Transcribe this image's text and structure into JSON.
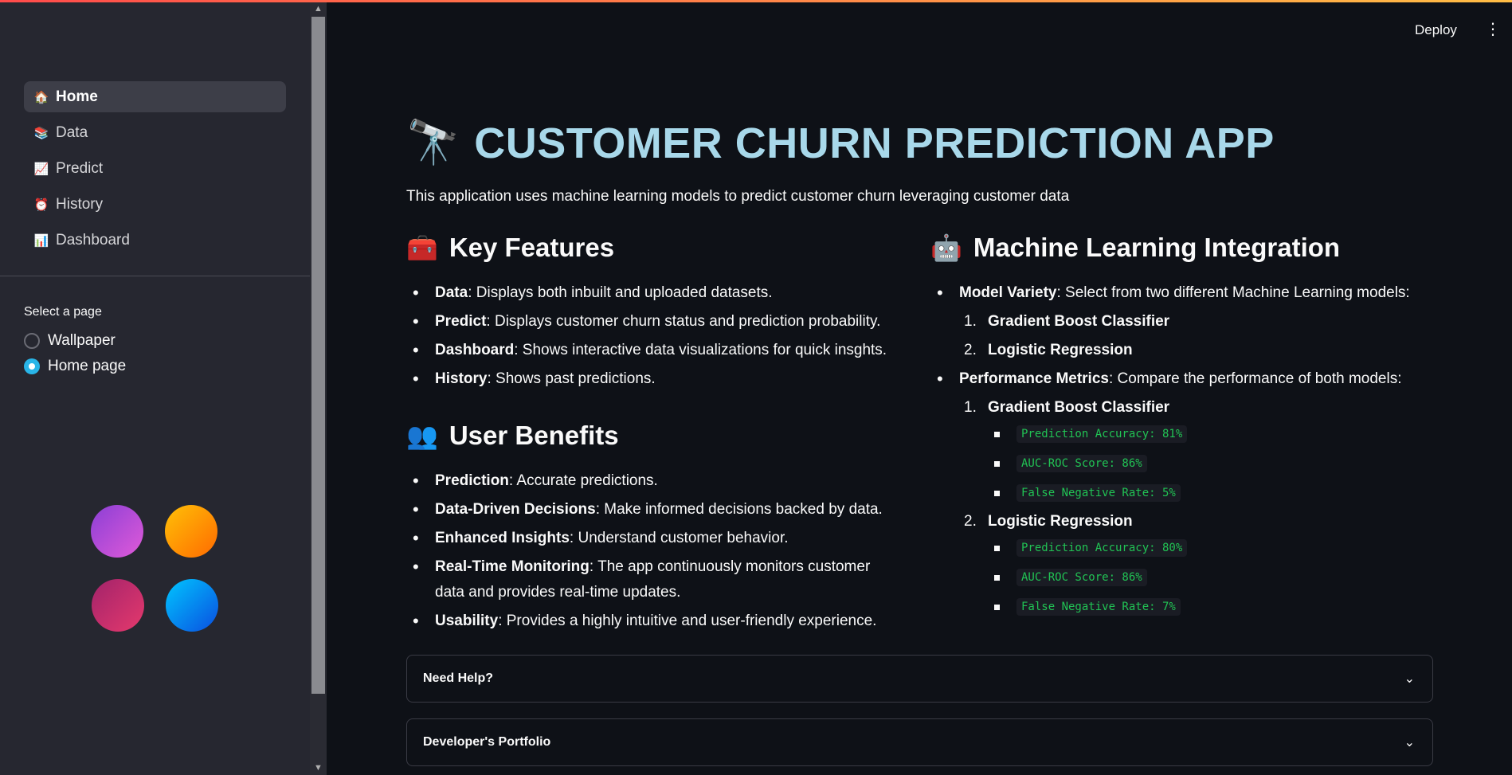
{
  "header": {
    "deploy_label": "Deploy",
    "menu_icon": "kebab-menu-icon"
  },
  "sidebar": {
    "nav": [
      {
        "label": "Home",
        "icon": "🏠",
        "active": true
      },
      {
        "label": "Data",
        "icon": "📚",
        "active": false
      },
      {
        "label": "Predict",
        "icon": "📈",
        "active": false
      },
      {
        "label": "History",
        "icon": "⏰",
        "active": false
      },
      {
        "label": "Dashboard",
        "icon": "📊",
        "active": false
      }
    ],
    "radio_label": "Select a page",
    "radio_options": [
      {
        "label": "Wallpaper",
        "selected": false
      },
      {
        "label": "Home page",
        "selected": true
      }
    ]
  },
  "main": {
    "title_icon": "🔭",
    "title": "CUSTOMER CHURN PREDICTION APP",
    "intro": "This application uses machine learning models to predict customer churn leveraging customer data",
    "key_features": {
      "icon": "🧰",
      "heading": "Key Features",
      "items": [
        {
          "bold": "Data",
          "text": ": Displays both inbuilt and uploaded datasets."
        },
        {
          "bold": "Predict",
          "text": ": Displays customer churn status and prediction probability."
        },
        {
          "bold": "Dashboard",
          "text": ": Shows interactive data visualizations for quick insghts."
        },
        {
          "bold": "History",
          "text": ": Shows past predictions."
        }
      ]
    },
    "user_benefits": {
      "icon": "👥",
      "heading": "User Benefits",
      "items": [
        {
          "bold": "Prediction",
          "text": ": Accurate predictions."
        },
        {
          "bold": "Data-Driven Decisions",
          "text": ": Make informed decisions backed by data."
        },
        {
          "bold": "Enhanced Insights",
          "text": ": Understand customer behavior."
        },
        {
          "bold": "Real-Time Monitoring",
          "text": ": The app continuously monitors customer data and provides real-time updates."
        },
        {
          "bold": "Usability",
          "text": ": Provides a highly intuitive and user-friendly experience."
        }
      ]
    },
    "ml": {
      "icon": "🤖",
      "heading": "Machine Learning Integration",
      "variety_bold": "Model Variety",
      "variety_text": ": Select from two different Machine Learning models:",
      "models": [
        "Gradient Boost Classifier",
        "Logistic Regression"
      ],
      "metrics_bold": "Performance Metrics",
      "metrics_text": ": Compare the performance of both models:",
      "metrics": [
        {
          "name": "Gradient Boost Classifier",
          "values": [
            "Prediction Accuracy: 81%",
            "AUC-ROC Score: 86%",
            "False Negative Rate: 5%"
          ]
        },
        {
          "name": "Logistic Regression",
          "values": [
            "Prediction Accuracy: 80%",
            "AUC-ROC Score: 86%",
            "False Negative Rate: 7%"
          ]
        }
      ]
    },
    "expanders": [
      {
        "label": "Need Help?"
      },
      {
        "label": "Developer's Portfolio"
      }
    ]
  },
  "colors": {
    "accent_title": "#a8d8ea",
    "radio_selected": "#29b5e8",
    "code_green": "#21c354"
  }
}
